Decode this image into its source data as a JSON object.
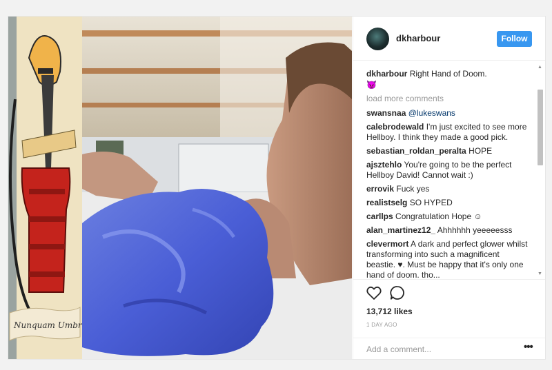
{
  "post": {
    "username": "dkharbour",
    "follow_label": "Follow",
    "caption": {
      "user": "dkharbour",
      "text": "Right Hand of Doom.",
      "emoji": "😈"
    },
    "load_more": "load more comments",
    "comments": [
      {
        "user": "swansnaa",
        "text": "@lukeswans",
        "is_mention": true
      },
      {
        "user": "calebrodewald",
        "text": "I'm just excited to see more Hellboy. I think they made a good pick."
      },
      {
        "user": "sebastian_roldan_peralta",
        "text": "HOPE"
      },
      {
        "user": "ajsztehlo",
        "text": "You're going to be the perfect Hellboy David! Cannot wait :)"
      },
      {
        "user": "errovik",
        "text": "Fuck yes"
      },
      {
        "user": "realistselg",
        "text": "SO HYPED"
      },
      {
        "user": "carllps",
        "text": "Congratulation Hope ☺"
      },
      {
        "user": "alan_martinez12_",
        "text": "Ahhhhhh yeeeeesss"
      },
      {
        "user": "clevermort",
        "text": "A dark and perfect glower whilst transforming into such a magnificent beastie. ♥. Must be happy that it's only one hand of doom. tho..."
      }
    ],
    "likes": "13,712 likes",
    "time": "1 DAY AGO",
    "add_comment_placeholder": "Add a comment...",
    "more_options": "•••"
  },
  "image": {
    "poster_handwriting": "Nunquam Umbra"
  },
  "icons": {
    "like": "heart-outline-icon",
    "comment": "speech-bubble-icon",
    "options": "more-options-icon"
  },
  "colors": {
    "follow_button": "#3897f0",
    "text": "#262626",
    "muted": "#999999"
  }
}
